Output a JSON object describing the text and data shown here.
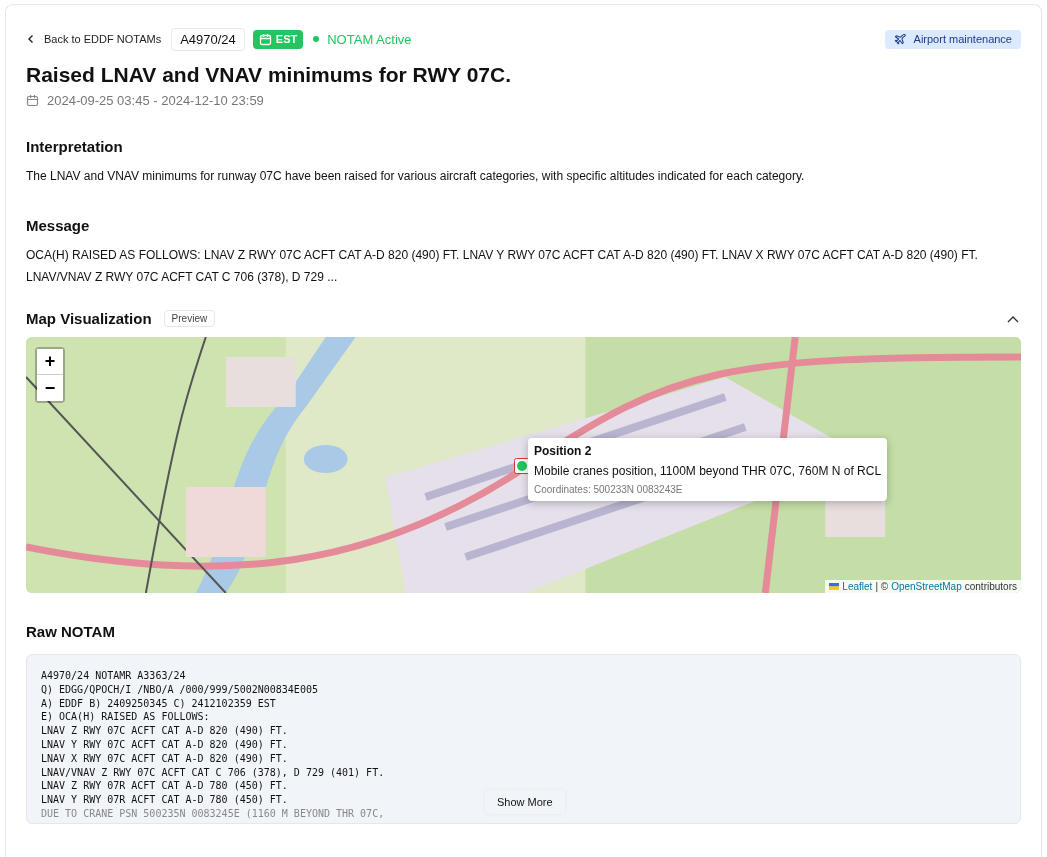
{
  "header": {
    "back_link": "Back to EDDF NOTAMs",
    "notam_id": "A4970/24",
    "timezone_badge": "EST",
    "status": {
      "label": "NOTAM Active",
      "active": true
    },
    "category": "Airport maintenance"
  },
  "title": "Raised LNAV and VNAV minimums for RWY 07C.",
  "validity": "2024-09-25 03:45 - 2024-12-10 23:59",
  "interpretation": {
    "heading": "Interpretation",
    "text": "The LNAV and VNAV minimums for runway 07C have been raised for various aircraft categories, with specific altitudes indicated for each category."
  },
  "message": {
    "heading": "Message",
    "text": "OCA(H) RAISED AS FOLLOWS: LNAV Z RWY 07C ACFT CAT A-D 820 (490) FT. LNAV Y RWY 07C ACFT CAT A-D 820 (490) FT. LNAV X RWY 07C ACFT CAT A-D 820 (490) FT. LNAV/VNAV Z RWY 07C ACFT CAT C 706 (378), D 729 ..."
  },
  "map": {
    "heading": "Map Visualization",
    "badge": "Preview",
    "expanded": true,
    "zoom_in": "+",
    "zoom_out": "−",
    "popup": {
      "title": "Position 2",
      "description": "Mobile cranes position, 1100M beyond THR 07C, 760M N of RCL",
      "coordinates": "Coordinates: 500233N 0083243E"
    },
    "attribution": {
      "leaflet": "Leaflet",
      "separator": "| ©",
      "osm": "OpenStreetMap",
      "suffix": "contributors"
    }
  },
  "raw": {
    "heading": "Raw NOTAM",
    "lines": [
      "A4970/24 NOTAMR A3363/24",
      "Q) EDGG/QPOCH/I /NBO/A /000/999/5002N00834E005",
      "A) EDDF B) 2409250345 C) 2412102359 EST",
      "E) OCA(H) RAISED AS FOLLOWS:",
      "LNAV Z RWY 07C ACFT CAT A-D 820 (490) FT.",
      "LNAV Y RWY 07C ACFT CAT A-D 820 (490) FT.",
      "LNAV X RWY 07C ACFT CAT A-D 820 (490) FT.",
      "LNAV/VNAV Z RWY 07C ACFT CAT C 706 (378), D 729 (401) FT.",
      "LNAV Z RWY 07R ACFT CAT A-D 780 (450) FT.",
      "LNAV Y RWY 07R ACFT CAT A-D 780 (450) FT.",
      "DUE TO CRANE PSN 500235N 0083245E (1160 M BEYOND THR 07C,"
    ],
    "show_more": "Show More"
  }
}
